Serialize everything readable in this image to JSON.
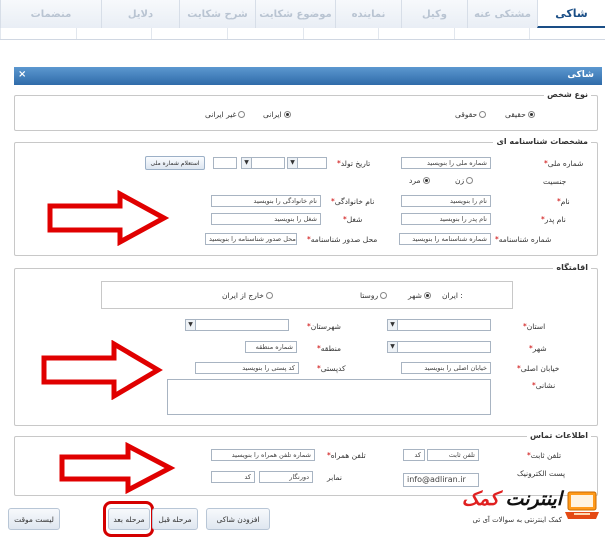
{
  "tabs": [
    {
      "label": "شاکی",
      "active": true
    },
    {
      "label": "مشتکی عنه",
      "active": false
    },
    {
      "label": "وکیل",
      "active": false
    },
    {
      "label": "نماینده",
      "active": false
    },
    {
      "label": "موضوع شکایت",
      "active": false
    },
    {
      "label": "شرح شکایت",
      "active": false
    },
    {
      "label": "دلایل",
      "active": false
    },
    {
      "label": "منضمات",
      "active": false
    }
  ],
  "dialog": {
    "title": "شاکی",
    "close": "×"
  },
  "person_type": {
    "legend": "نوع شخص",
    "options": [
      {
        "label": "حقیقی",
        "selected": true
      },
      {
        "label": "حقوقی",
        "selected": false
      },
      {
        "label": "ایرانی",
        "selected": true
      },
      {
        "label": "غیر ایرانی",
        "selected": false
      }
    ]
  },
  "identity": {
    "legend": "مشخصات شناسنامه ای",
    "national_code_label": "شماره ملی",
    "national_code_value": "شماره ملی را بنویسید",
    "birth_date_label": "تاریخ تولد",
    "inquiry_button": "استعلام شماره ملی",
    "gender_label": "جنسیت",
    "gender_male": "مرد",
    "gender_female": "زن",
    "first_name_label": "نام",
    "first_name_value": "نام را بنویسید",
    "last_name_label": "نام خانوادگی",
    "last_name_value": "نام خانوادگی را بنویسید",
    "father_label": "نام پدر",
    "father_value": "نام پدر را بنویسید",
    "job_label": "شغل",
    "job_value": "شغل را بنویسید",
    "id_number_label": "شماره شناسنامه",
    "id_number_value": "شماره شناسنامه را بنویسید",
    "issue_place_label": "محل صدور شناسنامه",
    "issue_place_value": "محل صدور شناسنامه را بنویسید"
  },
  "residence": {
    "legend": "اقامتگاه",
    "iran_label": "ایران :",
    "city_opt": "شهر",
    "village_opt": "روستا",
    "abroad_opt": "خارج از ایران",
    "province_label": "استان",
    "county_label": "شهرستان",
    "city_label": "شهر",
    "region_label": "منطقه",
    "region_value": "شماره منطقه",
    "street_label": "خیابان اصلی",
    "street_value": "خیابان اصلی را بنویسید",
    "postal_label": "کدپستی",
    "postal_value": "کد پستی را بنویسید",
    "address_label": "نشانی"
  },
  "contact": {
    "legend": "اطلاعات تماس",
    "phone_label": "تلفن ثابت",
    "phone_value": "تلفن ثابت",
    "area_code": "کد",
    "mobile_label": "تلفن همراه",
    "mobile_value": "شماره تلفن همراه را بنویسید",
    "email_label": "پست الکترونیک",
    "email_value": "info@adliran.ir",
    "fax_label": "نمابر",
    "fax_value": "دورنگار",
    "fax_code": "کد"
  },
  "buttons": {
    "back_list": "لیست موقت",
    "next": "مرحله بعد",
    "prev": "مرحله قبل",
    "add": "افزودن شاکی"
  },
  "logo": {
    "main_a": "اینترنت",
    "main_b": "کمک",
    "sub": "کمک اینترنتی به سوالات آی تی"
  },
  "colors": {
    "accent": "#2f6ba9",
    "arrow": "#e00000"
  }
}
